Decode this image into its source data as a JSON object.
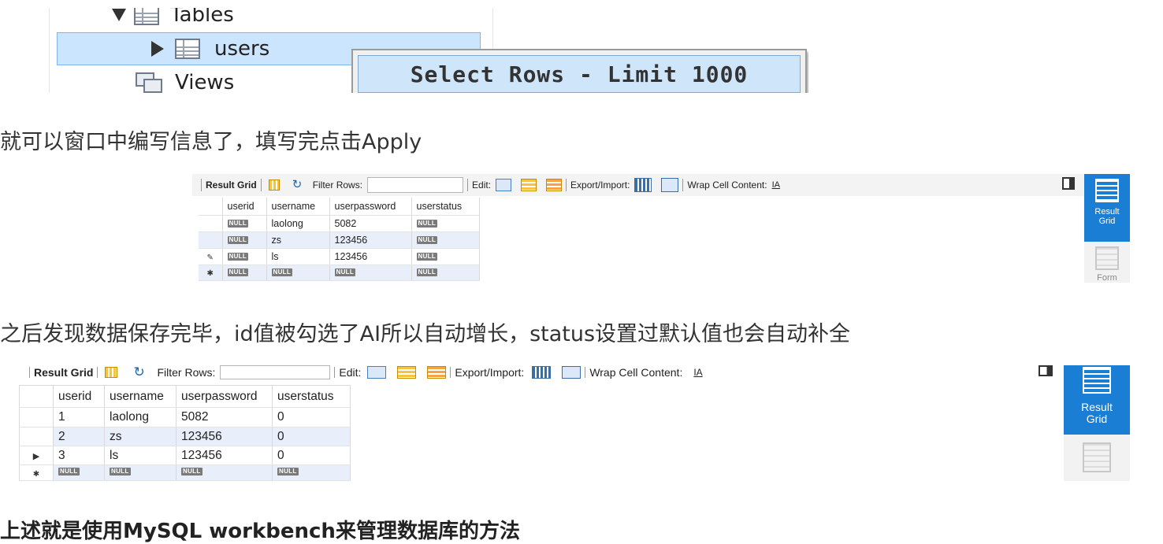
{
  "tree": {
    "tables_label": "Tables",
    "users_label": "users",
    "views_label": "Views",
    "context_menu_item": "Select Rows - Limit 1000"
  },
  "paragraphs": {
    "p1": "就可以窗口中编写信息了，填写完点击Apply",
    "p2": "之后发现数据保存完毕，id值被勾选了AI所以自动增长，status设置过默认值也会自动补全",
    "p3": "上述就是使用MySQL workbench来管理数据库的方法"
  },
  "toolbar": {
    "result_grid": "Result Grid",
    "filter_rows": "Filter Rows:",
    "edit": "Edit:",
    "export_import": "Export/Import:",
    "wrap_cell": "Wrap Cell Content:",
    "wrap_glyph": "IA"
  },
  "side_panel": {
    "result_grid_line1": "Result",
    "result_grid_line2": "Grid",
    "form": "Form"
  },
  "grid1": {
    "columns": [
      "userid",
      "username",
      "userpassword",
      "userstatus"
    ],
    "rows": [
      [
        "NULL",
        "laolong",
        "5082",
        "NULL"
      ],
      [
        "NULL",
        "zs",
        "123456",
        "NULL"
      ],
      [
        "NULL",
        "ls",
        "123456",
        "NULL"
      ],
      [
        "NULL",
        "NULL",
        "NULL",
        "NULL"
      ]
    ]
  },
  "grid2": {
    "columns": [
      "userid",
      "username",
      "userpassword",
      "userstatus"
    ],
    "rows": [
      [
        "1",
        "laolong",
        "5082",
        "0"
      ],
      [
        "2",
        "zs",
        "123456",
        "0"
      ],
      [
        "3",
        "ls",
        "123456",
        "0"
      ],
      [
        "NULL",
        "NULL",
        "NULL",
        "NULL"
      ]
    ]
  },
  "null_badge": "NULL",
  "colors": {
    "selection": "#cce5ff",
    "accent": "#1a7fd4",
    "alt_row": "#e8eefa"
  }
}
